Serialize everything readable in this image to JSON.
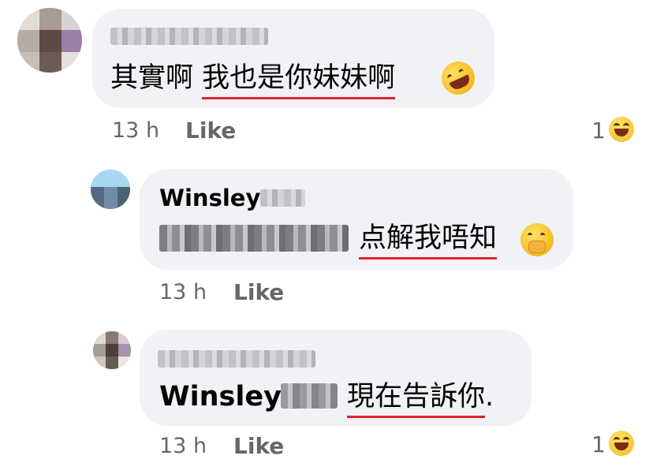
{
  "comments": [
    {
      "text": "其實啊 ",
      "underlined": "我也是你妹妹啊",
      "time": "13 h",
      "like_label": "Like",
      "reaction_count": "1",
      "emoji": "rolling-on-floor-laughing-icon",
      "reaction_icon": "haha-reaction-icon"
    },
    {
      "author": "Winsley",
      "underlined": "点解我唔知",
      "time": "13 h",
      "like_label": "Like",
      "emoji": "face-with-hand-over-mouth-icon"
    },
    {
      "mention": "Winsley",
      "underlined": "現在告訴你",
      "trail": ".",
      "time": "13 h",
      "like_label": "Like",
      "reaction_count": "1",
      "reaction_icon": "haha-reaction-icon"
    }
  ],
  "colors": {
    "bubble": "#f0f2f5",
    "underline": "#e0242f",
    "meta_text": "#65676b",
    "body_text": "#050505"
  }
}
